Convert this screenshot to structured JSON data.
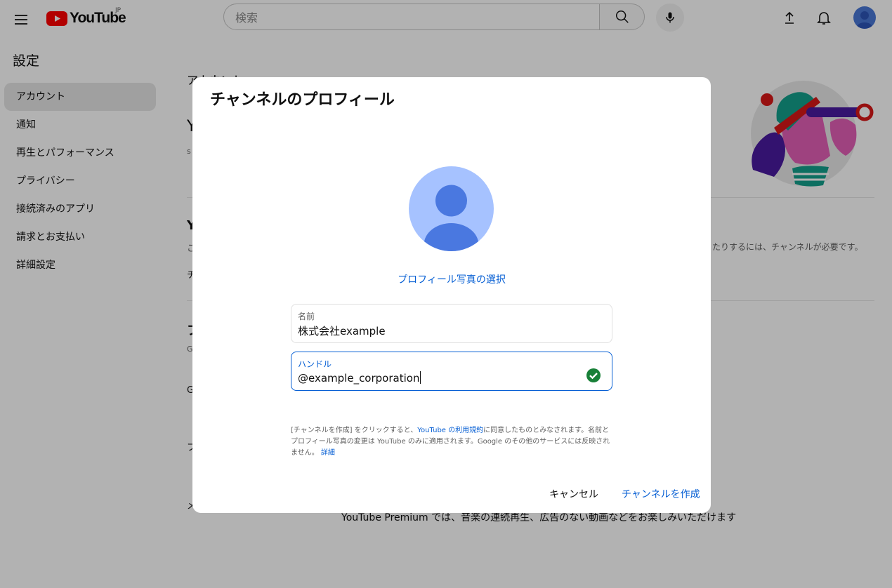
{
  "header": {
    "logo_text": "YouTube",
    "logo_region": "JP",
    "search_placeholder": "検索",
    "icons": {
      "menu": "menu-icon",
      "search": "search-icon",
      "mic": "mic-icon",
      "upload": "upload-icon",
      "notifications": "bell-icon",
      "account": "avatar-icon"
    }
  },
  "sidebar": {
    "title": "設定",
    "items": [
      {
        "label": "アカウント",
        "active": true
      },
      {
        "label": "通知"
      },
      {
        "label": "再生とパフォーマンス"
      },
      {
        "label": "プライバシー"
      },
      {
        "label": "接続済みのアプリ"
      },
      {
        "label": "請求とお支払い"
      },
      {
        "label": "詳細設定"
      }
    ]
  },
  "main": {
    "section_title": "アカウント",
    "partial_1": "Y",
    "partial_2": "s",
    "partial_3": "Y",
    "partial_4": "こ",
    "channel_requirement_text": "たりするには、チャンネルが必要です。",
    "partial_5": "チ",
    "partial_6": "フ",
    "partial_7": "G",
    "partial_8": "G",
    "partial_9": "フ",
    "partial_10": "メ",
    "premium_text": "YouTube Premium では、音楽の連続再生、広告のない動画などをお楽しみいただけます"
  },
  "dialog": {
    "title": "チャンネルのプロフィール",
    "choose_photo": "プロフィール写真の選択",
    "name_field": {
      "label": "名前",
      "value": "株式会社example"
    },
    "handle_field": {
      "label": "ハンドル",
      "value": "@example_corporation",
      "valid": true
    },
    "terms": {
      "part1": "[チャンネルを作成] をクリックすると、",
      "link1": "YouTube の利用規約",
      "part2": "に同意したものとみなされます。名前とプロフィール写真の変更は YouTube のみに適用されます。Google のその他のサービスには反映されません。",
      "link2": "詳細"
    },
    "cancel_label": "キャンセル",
    "create_label": "チャンネルを作成"
  },
  "colors": {
    "accent": "#065fd4",
    "brand_red": "#ff0000",
    "success": "#188038",
    "overlay": "rgba(0,0,0,0.3)"
  }
}
